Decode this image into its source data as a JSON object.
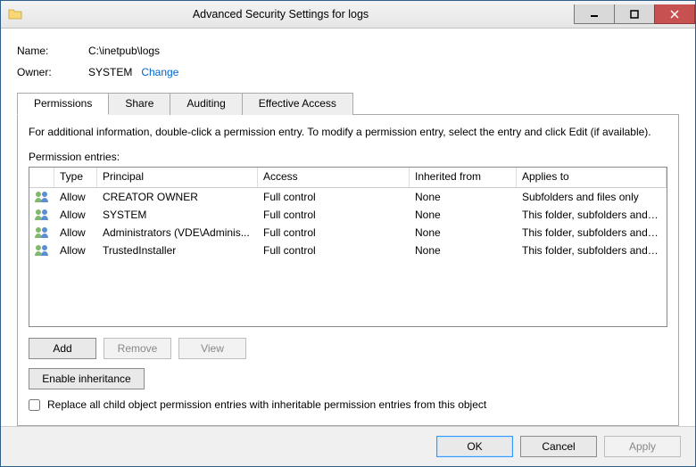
{
  "window": {
    "title": "Advanced Security Settings for logs"
  },
  "fields": {
    "name_label": "Name:",
    "name_value": "C:\\inetpub\\logs",
    "owner_label": "Owner:",
    "owner_value": "SYSTEM",
    "change_link": "Change"
  },
  "tabs": {
    "permissions": "Permissions",
    "share": "Share",
    "auditing": "Auditing",
    "effective": "Effective Access"
  },
  "panel": {
    "info": "For additional information, double-click a permission entry. To modify a permission entry, select the entry and click Edit (if available).",
    "entries_label": "Permission entries:"
  },
  "columns": {
    "blank": "",
    "type": "Type",
    "principal": "Principal",
    "access": "Access",
    "inherited": "Inherited from",
    "applies": "Applies to"
  },
  "rows": [
    {
      "type": "Allow",
      "principal": "CREATOR OWNER",
      "access": "Full control",
      "inherited": "None",
      "applies": "Subfolders and files only"
    },
    {
      "type": "Allow",
      "principal": "SYSTEM",
      "access": "Full control",
      "inherited": "None",
      "applies": "This folder, subfolders and files"
    },
    {
      "type": "Allow",
      "principal": "Administrators (VDE\\Adminis...",
      "access": "Full control",
      "inherited": "None",
      "applies": "This folder, subfolders and files"
    },
    {
      "type": "Allow",
      "principal": "TrustedInstaller",
      "access": "Full control",
      "inherited": "None",
      "applies": "This folder, subfolders and files"
    }
  ],
  "buttons": {
    "add": "Add",
    "remove": "Remove",
    "view": "View",
    "enable_inheritance": "Enable inheritance",
    "ok": "OK",
    "cancel": "Cancel",
    "apply": "Apply"
  },
  "checkbox": {
    "replace_label": "Replace all child object permission entries with inheritable permission entries from this object"
  }
}
